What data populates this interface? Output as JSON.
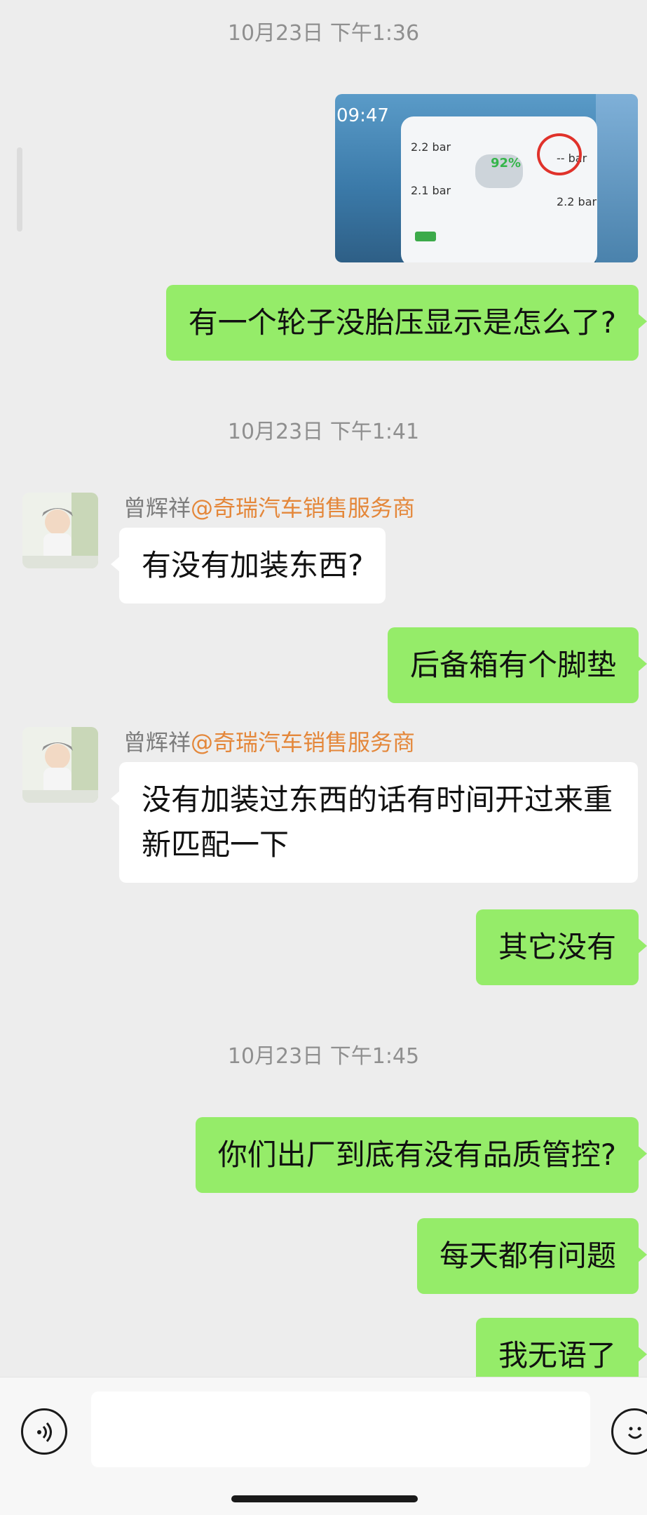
{
  "messages": {
    "ts1": "10月23日 下午1:36",
    "photo_clock": "09:47",
    "photo_battery": "92%",
    "photo_tp_fl": "2.2 bar",
    "photo_tp_rl": "2.1 bar",
    "photo_tp_fr": "-- bar",
    "photo_tp_rr": "2.2 bar",
    "m1": "有一个轮子没胎压显示是怎么了?",
    "ts2": "10月23日 下午1:41",
    "sender_name": "曾辉祥",
    "sender_org": "@奇瑞汽车销售服务商",
    "m2": "有没有加装东西?",
    "m3": "后备箱有个脚垫",
    "m4": "没有加装过东西的话有时间开过来重新匹配一下",
    "m5": "其它没有",
    "ts3": "10月23日 下午1:45",
    "m6": "你们出厂到底有没有品质管控?",
    "m7": "每天都有问题",
    "m8": "我无语了"
  },
  "input_bar": {
    "voice_icon": "voice-icon",
    "emoji_icon": "emoji-icon",
    "text_value": ""
  },
  "colors": {
    "outgoing_bubble": "#95ec69",
    "incoming_bubble": "#ffffff",
    "background": "#ededed",
    "sender_org": "#e4873a"
  }
}
